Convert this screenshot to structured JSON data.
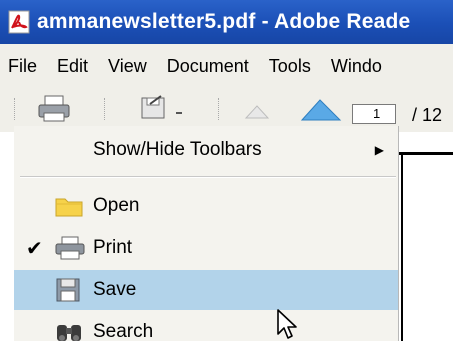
{
  "window": {
    "title": "ammanewsletter5.pdf - Adobe Reade",
    "icon": "pdf-icon"
  },
  "menubar": {
    "items": [
      "File",
      "Edit",
      "View",
      "Document",
      "Tools",
      "Windo"
    ]
  },
  "toolbar": {
    "page_number": "1",
    "page_total": "/ 12",
    "icons": [
      "print-icon",
      "save-icon",
      "previous-page-icon",
      "next-page-icon"
    ]
  },
  "dropdown": {
    "items": [
      {
        "label": "Show/Hide Toolbars",
        "submenu": true,
        "icon": "",
        "checked": false,
        "highlighted": false
      },
      {
        "label": "Open",
        "submenu": false,
        "icon": "folder-icon",
        "checked": false,
        "highlighted": false
      },
      {
        "label": "Print",
        "submenu": false,
        "icon": "printer-icon",
        "checked": true,
        "highlighted": false
      },
      {
        "label": "Save",
        "submenu": false,
        "icon": "floppy-disk-icon",
        "checked": false,
        "highlighted": true
      },
      {
        "label": "Search",
        "submenu": false,
        "icon": "binoculars-icon",
        "checked": false,
        "highlighted": false
      }
    ]
  },
  "colors": {
    "titlebar": "#1b4fb6",
    "menu_highlight": "#b2d3ea",
    "folder": "#f6d24a"
  }
}
